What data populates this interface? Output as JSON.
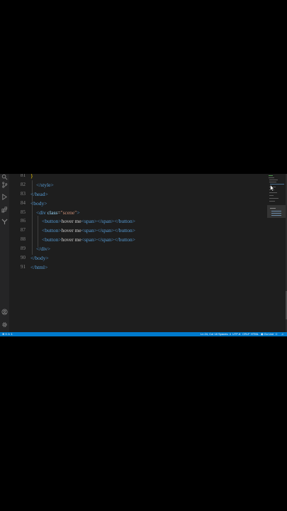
{
  "editor": {
    "lines": [
      {
        "num": "81"
      },
      {
        "num": "82",
        "text": "</style>"
      },
      {
        "num": "83",
        "text": "</head>"
      },
      {
        "num": "84",
        "text": "<body>"
      },
      {
        "num": "85",
        "open": "<div ",
        "attr": "class",
        "eq": "=",
        "value": "\"scene\"",
        "close": ">"
      },
      {
        "num": "86",
        "open": "<button>",
        "content": "hover me",
        "inner_open": "<span>",
        "inner_close": "</span>",
        "close": "</button>"
      },
      {
        "num": "87",
        "open": "<button>",
        "content": "hover me",
        "inner_open": "<span>",
        "inner_close": "</span>",
        "close": "</button>"
      },
      {
        "num": "88",
        "open": "<button>",
        "content": "hover me",
        "inner_open": "<span>",
        "inner_close": "</span>",
        "close": "</button>"
      },
      {
        "num": "89",
        "text": "</div>"
      },
      {
        "num": "90",
        "text": "</body>"
      },
      {
        "num": "91",
        "text": "</html>"
      }
    ],
    "first_line_brace": "}"
  },
  "statusbar": {
    "left": "⊗ 0 ⚠ 1",
    "position": "Ln 24, Col 18",
    "spaces": "Spaces: 4",
    "encoding": "UTF-8",
    "eol": "CRLF",
    "language": "HTML",
    "golive": "Go Live",
    "accent": "#007acc"
  },
  "activity_icons": [
    "search-icon",
    "source-control-icon",
    "run-debug-icon",
    "extensions-icon",
    "remote-icon",
    "account-icon",
    "settings-gear-icon"
  ]
}
